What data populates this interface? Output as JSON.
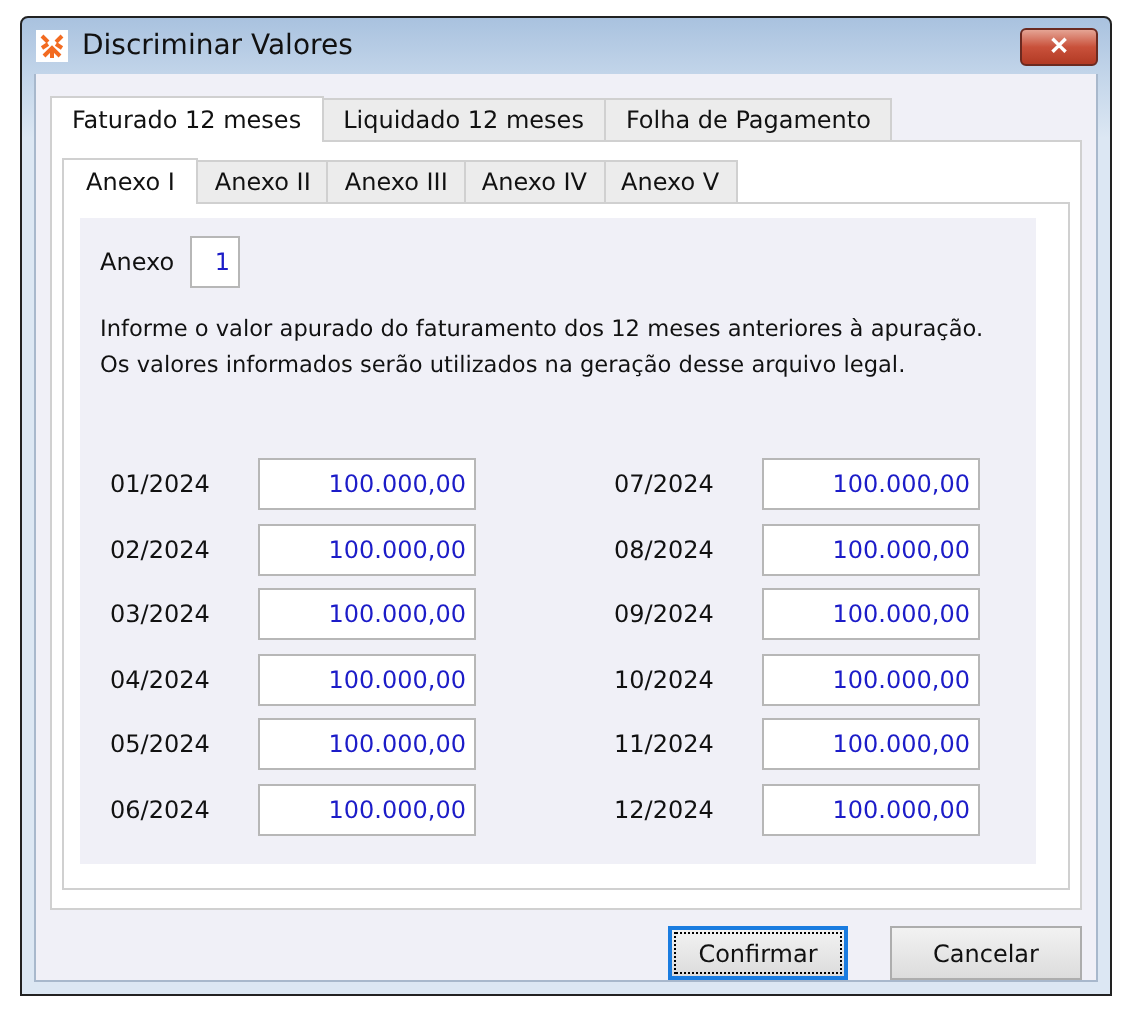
{
  "window": {
    "title": "Discriminar Valores",
    "close": "✕"
  },
  "tabs": [
    {
      "label": "Faturado 12 meses",
      "selected": true
    },
    {
      "label": "Liquidado 12 meses",
      "selected": false
    },
    {
      "label": "Folha de Pagamento",
      "selected": false
    }
  ],
  "annex_tabs": [
    {
      "label": "Anexo I",
      "selected": true
    },
    {
      "label": "Anexo II",
      "selected": false
    },
    {
      "label": "Anexo III",
      "selected": false
    },
    {
      "label": "Anexo IV",
      "selected": false
    },
    {
      "label": "Anexo V",
      "selected": false
    }
  ],
  "annex": {
    "label": "Anexo",
    "value": "1"
  },
  "info": [
    "Informe o valor apurado do faturamento dos 12 meses anteriores à apuração.",
    "Os valores informados serão utilizados na geração desse arquivo legal."
  ],
  "months": [
    {
      "month": "01/2024",
      "value": "100.000,00"
    },
    {
      "month": "02/2024",
      "value": "100.000,00"
    },
    {
      "month": "03/2024",
      "value": "100.000,00"
    },
    {
      "month": "04/2024",
      "value": "100.000,00"
    },
    {
      "month": "05/2024",
      "value": "100.000,00"
    },
    {
      "month": "06/2024",
      "value": "100.000,00"
    },
    {
      "month": "07/2024",
      "value": "100.000,00"
    },
    {
      "month": "08/2024",
      "value": "100.000,00"
    },
    {
      "month": "09/2024",
      "value": "100.000,00"
    },
    {
      "month": "10/2024",
      "value": "100.000,00"
    },
    {
      "month": "11/2024",
      "value": "100.000,00"
    },
    {
      "month": "12/2024",
      "value": "100.000,00"
    }
  ],
  "buttons": [
    {
      "label": "Confirmar",
      "default": true
    },
    {
      "label": "Cancelar",
      "default": false
    }
  ]
}
